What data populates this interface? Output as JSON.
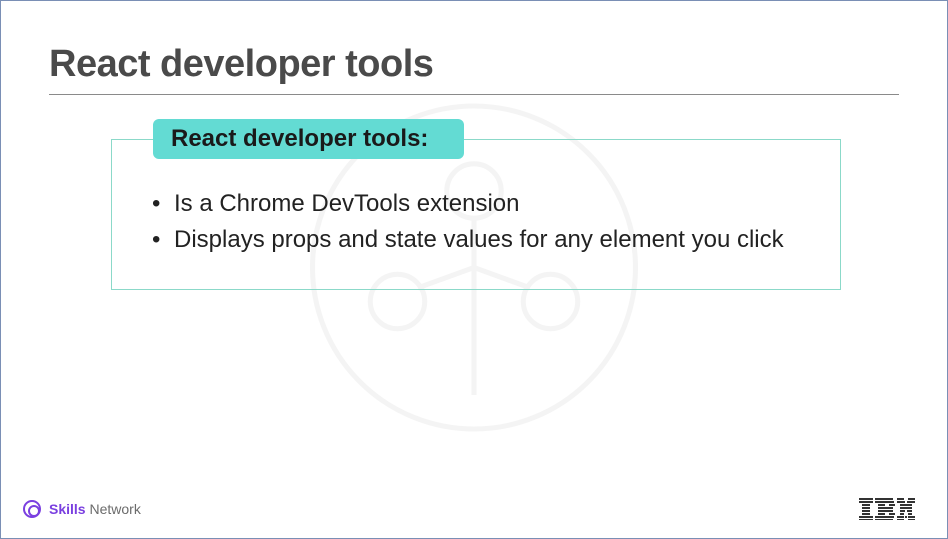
{
  "slide": {
    "title": "React developer tools",
    "box_label": "React developer tools:",
    "bullets": [
      "Is a Chrome DevTools extension",
      "Displays props and state values for any element you click"
    ]
  },
  "footer": {
    "skills_bold": "Skills",
    "skills_rest": " Network",
    "ibm": "IBM"
  }
}
